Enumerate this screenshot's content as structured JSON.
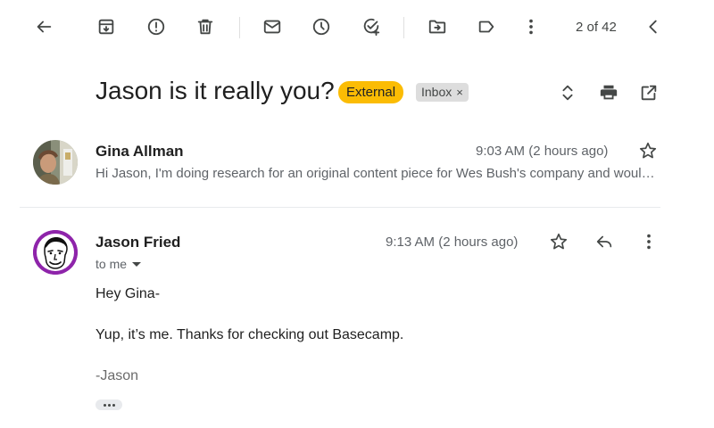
{
  "toolbar": {
    "actions": [
      {
        "name": "back-arrow-icon",
        "label": "Back"
      },
      {
        "name": "archive-icon",
        "label": "Archive"
      },
      {
        "name": "report-spam-icon",
        "label": "Report spam"
      },
      {
        "name": "delete-icon",
        "label": "Delete"
      },
      {
        "name": "mark-unread-icon",
        "label": "Mark as unread"
      },
      {
        "name": "snooze-icon",
        "label": "Snooze"
      },
      {
        "name": "add-task-icon",
        "label": "Add to tasks"
      },
      {
        "name": "move-to-icon",
        "label": "Move to"
      },
      {
        "name": "label-icon",
        "label": "Labels"
      },
      {
        "name": "more-vertical-icon",
        "label": "More"
      }
    ],
    "page_count": "2 of 42"
  },
  "thread": {
    "subject": "Jason is it really you?",
    "labels": {
      "external": "External",
      "inbox": "Inbox",
      "inbox_remove": "×"
    },
    "colors": {
      "external_label_bg": "#fbbc04",
      "inbox_label_bg": "#dddddd"
    }
  },
  "messages": [
    {
      "sender": "Gina Allman",
      "time": "9:03 AM (2 hours ago)",
      "snippet": "Hi Jason, I'm doing research for an original content piece for Wes Bush's company and would love to get your input",
      "collapsed": true
    },
    {
      "sender": "Jason Fried",
      "time": "9:13 AM (2 hours ago)",
      "recipient": "to me",
      "body": {
        "greeting": "Hey Gina-",
        "line1": "Yup, it’s me. Thanks for checking out Basecamp.",
        "signature": "-Jason"
      },
      "collapsed": false,
      "avatar_ring_color": "#8e24aa"
    }
  ]
}
